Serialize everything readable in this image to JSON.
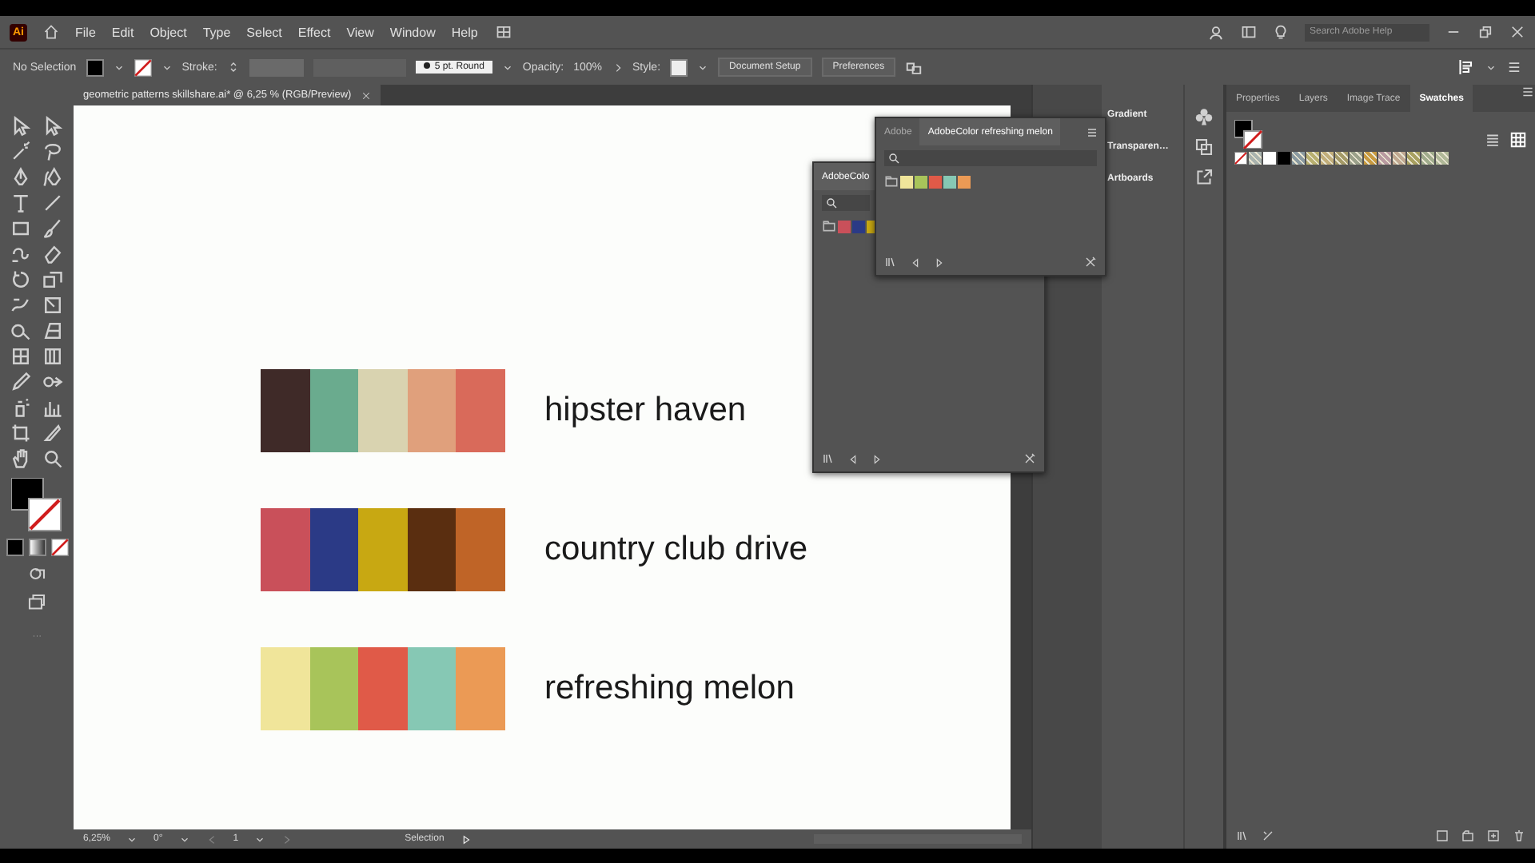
{
  "menu_bar": {
    "logo": "Ai",
    "items": [
      "File",
      "Edit",
      "Object",
      "Type",
      "Select",
      "Effect",
      "View",
      "Window",
      "Help"
    ],
    "search": {
      "placeholder": "Search Adobe Help"
    }
  },
  "control_bar": {
    "selection": "No Selection",
    "stroke_label": "Stroke:",
    "brush": "5 pt. Round",
    "opacity_label": "Opacity:",
    "opacity": "100%",
    "style_label": "Style:",
    "buttons": [
      "Document Setup",
      "Preferences"
    ]
  },
  "document_tab": {
    "title": "geometric patterns skillshare.ai* @ 6,25 % (RGB/Preview)"
  },
  "palettes": [
    {
      "name": "hipster haven",
      "colors": [
        {
          "color": "#3f2a28"
        },
        {
          "color": "#6aab8e"
        },
        {
          "color": "#d9d3b0"
        },
        {
          "color": "#e0a07c"
        },
        {
          "color": "#d96a5a"
        }
      ]
    },
    {
      "name": "country club drive",
      "colors": [
        {
          "color": "#c9505a"
        },
        {
          "color": "#2b3a86"
        },
        {
          "color": "#c8a812"
        },
        {
          "color": "#5a2e10"
        },
        {
          "color": "#bf6427"
        }
      ]
    },
    {
      "name": "refreshing melon",
      "colors": [
        {
          "color": "#f0e59a"
        },
        {
          "color": "#a8c45a"
        },
        {
          "color": "#e05a48"
        },
        {
          "color": "#86c8b4"
        },
        {
          "color": "#eb9a55"
        }
      ]
    }
  ],
  "floating_panels": [
    {
      "tabs": [
        {
          "label": "AdobeColo",
          "selected": true
        }
      ],
      "swatches": [
        {
          "color": "#c9505a"
        },
        {
          "color": "#2b3a86"
        },
        {
          "color": "#c8a812"
        }
      ]
    },
    {
      "tabs": [
        {
          "label": "Adobe",
          "selected": false
        },
        {
          "label": "AdobeColor refreshing melon",
          "selected": true
        }
      ],
      "swatches": [
        {
          "color": "#f0e59a"
        },
        {
          "color": "#a8c45a"
        },
        {
          "color": "#e05a48"
        },
        {
          "color": "#86c8b4"
        },
        {
          "color": "#eb9a55"
        }
      ]
    }
  ],
  "dock_panels": [
    "Gradient",
    "Transparen…",
    "Artboards"
  ],
  "right_panel": {
    "tabs": [
      {
        "label": "Properties",
        "selected": false
      },
      {
        "label": "Layers",
        "selected": false
      },
      {
        "label": "Image Trace",
        "selected": false
      },
      {
        "label": "Swatches",
        "selected": true
      }
    ],
    "swatches": [
      {
        "kind": "none"
      },
      {
        "kind": "pattern",
        "color": "#a9b3ae"
      },
      {
        "kind": "solid",
        "color": "#ffffff"
      },
      {
        "kind": "solid",
        "color": "#000000"
      },
      {
        "kind": "pattern",
        "color": "#8a9aa0"
      },
      {
        "kind": "pattern",
        "color": "#b8b070"
      },
      {
        "kind": "pattern",
        "color": "#c2ae7a"
      },
      {
        "kind": "pattern",
        "color": "#a49a68"
      },
      {
        "kind": "pattern",
        "color": "#9aa08a"
      },
      {
        "kind": "pattern",
        "color": "#c89a40"
      },
      {
        "kind": "pattern",
        "color": "#b89aa0"
      },
      {
        "kind": "pattern",
        "color": "#c0a890"
      },
      {
        "kind": "pattern",
        "color": "#a8a060"
      },
      {
        "kind": "pattern",
        "color": "#a0ac8c"
      },
      {
        "kind": "pattern",
        "color": "#b0b898"
      }
    ]
  },
  "status_bar": {
    "zoom": "6,25%",
    "rotation": "0°",
    "artboard": "1",
    "tool": "Selection"
  }
}
